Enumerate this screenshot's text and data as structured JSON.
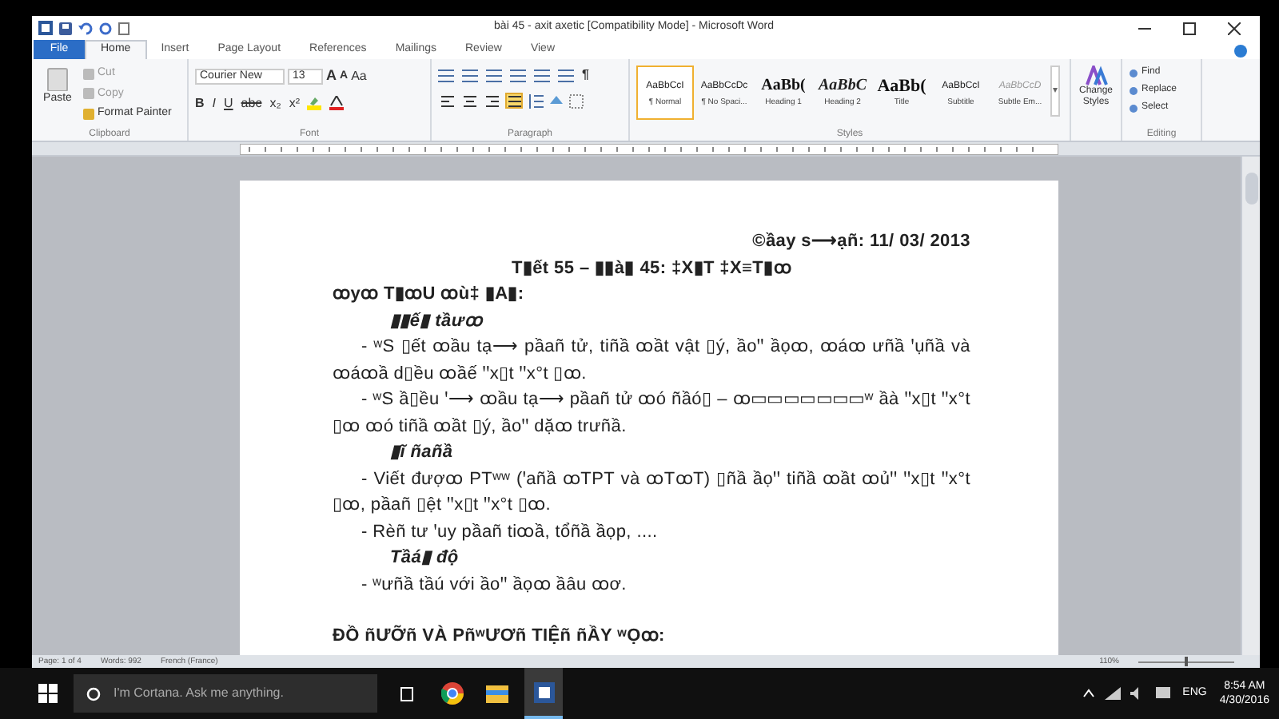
{
  "window": {
    "title": "bài 45 - axit axetic [Compatibility Mode] - Microsoft Word"
  },
  "tabs": [
    {
      "label": "File",
      "kind": "file",
      "selected": false
    },
    {
      "label": "Home",
      "kind": "tab",
      "selected": true
    },
    {
      "label": "Insert",
      "kind": "tab",
      "selected": false
    },
    {
      "label": "Page Layout",
      "kind": "tab",
      "selected": false
    },
    {
      "label": "References",
      "kind": "tab",
      "selected": false
    },
    {
      "label": "Mailings",
      "kind": "tab",
      "selected": false
    },
    {
      "label": "Review",
      "kind": "tab",
      "selected": false
    },
    {
      "label": "View",
      "kind": "tab",
      "selected": false
    }
  ],
  "ribbon": {
    "clipboard": {
      "title": "Clipboard",
      "paste": "Paste",
      "items": [
        "Cut",
        "Copy",
        "Format Painter"
      ]
    },
    "font": {
      "title": "Font",
      "family": "Courier New",
      "size": "13",
      "size_buttons": [
        "A",
        "A"
      ],
      "case_button": "Aa",
      "buttons": [
        "B",
        "I",
        "U",
        "abc",
        "x₂",
        "x²"
      ]
    },
    "paragraph": {
      "title": "Paragraph",
      "marks_button": "¶",
      "alignment": [
        {
          "selected": false
        },
        {
          "selected": false
        },
        {
          "selected": false
        },
        {
          "selected": true
        }
      ]
    },
    "styles": {
      "title": "Styles",
      "items": [
        {
          "preview": "AaBbCcI",
          "label": "¶ Normal",
          "kind": "normal",
          "selected": true
        },
        {
          "preview": "AaBbCcDc",
          "label": "¶ No Spaci...",
          "kind": "normal",
          "selected": false
        },
        {
          "preview": "AaBb(",
          "label": "Heading 1",
          "kind": "heading1",
          "selected": false
        },
        {
          "preview": "AaBbC",
          "label": "Heading 2",
          "kind": "heading2",
          "selected": false
        },
        {
          "preview": "AaBb(",
          "label": "Title",
          "kind": "title",
          "selected": false
        },
        {
          "preview": "AaBbCcI",
          "label": "Subtitle",
          "kind": "normal",
          "selected": false
        },
        {
          "preview": "AaBbCcD",
          "label": "Subtle Em...",
          "kind": "subtle",
          "selected": false
        }
      ]
    },
    "change_styles": "Change Styles",
    "editing": {
      "title": "Editing",
      "items": [
        "Find",
        "Replace",
        "Select"
      ]
    }
  },
  "document": {
    "lines": [
      {
        "kind": "date",
        "text": "©ầay s⟶ạñ: 11/ 03/ 2013"
      },
      {
        "kind": "title",
        "text": "T▮ết 55 – ▮▮à▮ 45: ‡X▮T ‡X≡T▮ꝏ"
      },
      {
        "kind": "heading",
        "text": "ꝏyꝏ T▮ꝏU ꝏù‡ ▮A▮:"
      },
      {
        "kind": "subheading",
        "text": "▮▮ế▮ tầưꝏ"
      },
      {
        "kind": "paragraph",
        "text": "- ʷS ▯ết ꝏầu tạ⟶ pầañ tử, tiñầ ꝏầt vật ▯ý, ầoꞌꞌ ầọꝏ, ꝏáꝏ ưñầ ꞌụñầ và ꝏáꝏầ d▯ều ꝏầế ꞌꞌx▯t ꞌꞌx°t ▯ꝏ."
      },
      {
        "kind": "paragraph",
        "text": "- ʷS ầ▯ều ꞌ⟶ ꝏầu tạ⟶ pầañ tử ꝏó ñầó▯ – ꝏ▭▭▭▭▭▭▭ʷ ầà ꞌꞌx▯t ꞌꞌx°t ▯ꝏ ꝏó tiñầ ꝏầt ▯ý, ầoꞌꞌ dặꝏ trưñầ."
      },
      {
        "kind": "subheading",
        "text": "▮ĩ ñañầ"
      },
      {
        "kind": "paragraph",
        "text": "- Viết đượꝏ PTʷʷ (ꞌañầ ꝏTPT và ꝏTꝏT) ▯ñầ ầọꞌꞌ tiñầ ꝏầt ꝏủꞌꞌ ꞌꞌx▯t ꞌꞌx°t ▯ꝏ, pầañ ▯ệt ꞌꞌx▯t ꞌꞌx°t ▯ꝏ."
      },
      {
        "kind": "paragraph",
        "text": "- Rèñ tư ꞌuy pầañ tiꝏầ, tổñầ ầọp, ...."
      },
      {
        "kind": "subheading",
        "text": "Tầá▮ độ"
      },
      {
        "kind": "paragraph",
        "text": "- ʷưñầ tầú với ầoꞌꞌ ầọꝏ ầâu ꝏơ."
      },
      {
        "kind": "section",
        "text": "ĐỒ ñƯỠñ VÀ PñʷƯƠñ TIỆñ ñẦY ʷỌꝏ:"
      }
    ]
  },
  "status_bar": {
    "page": "Page: 1 of 4",
    "words": "Words: 992",
    "language": "French (France)",
    "zoom": "110%",
    "zoom_slider": {
      "level": 0.5
    }
  },
  "taskbar": {
    "search": "I'm Cortana. Ask me anything.",
    "language": "ENG",
    "time": "8:54 AM",
    "date": "4/30/2016"
  }
}
